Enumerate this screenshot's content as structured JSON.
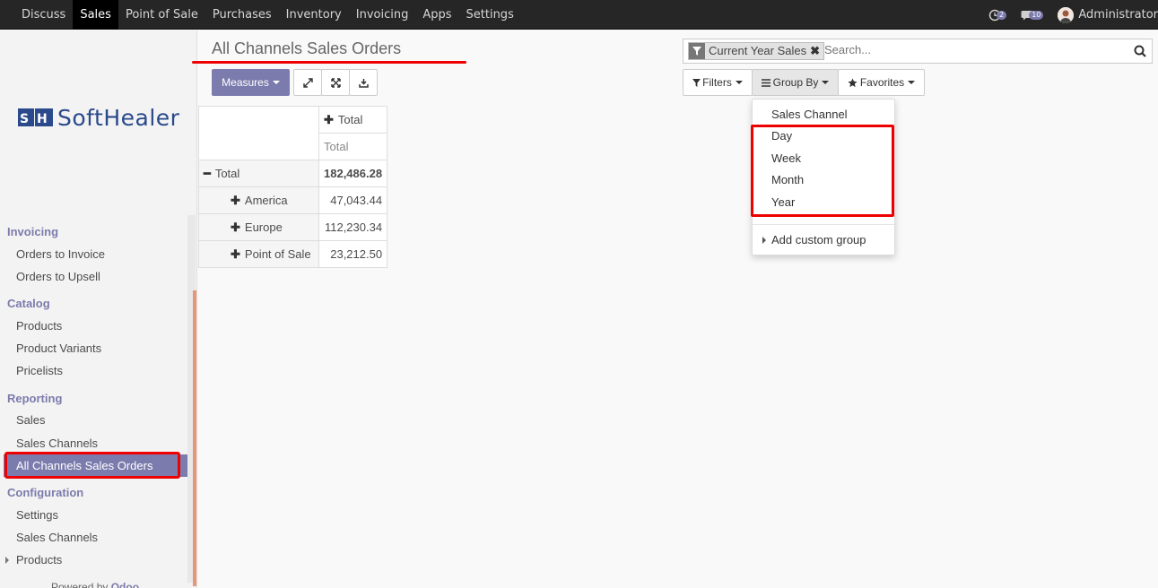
{
  "topbar": {
    "menu": [
      {
        "label": "Discuss"
      },
      {
        "label": "Sales"
      },
      {
        "label": "Point of Sale"
      },
      {
        "label": "Purchases"
      },
      {
        "label": "Inventory"
      },
      {
        "label": "Invoicing"
      },
      {
        "label": "Apps"
      },
      {
        "label": "Settings"
      }
    ],
    "activities_count": "2",
    "messages_count": "10",
    "user": "Administrator"
  },
  "sidebar": {
    "logo_text": "SoftHealer",
    "sections": [
      {
        "title": "Invoicing",
        "items": [
          "Orders to Invoice",
          "Orders to Upsell"
        ]
      },
      {
        "title": "Catalog",
        "items": [
          "Products",
          "Product Variants",
          "Pricelists"
        ]
      },
      {
        "title": "Reporting",
        "items": [
          "Sales",
          "Sales Channels",
          "All Channels Sales Orders"
        ]
      },
      {
        "title": "Configuration",
        "items": [
          "Settings",
          "Sales Channels",
          "Products"
        ]
      }
    ],
    "powered_prefix": "Powered by",
    "powered_brand": "Odoo"
  },
  "control_panel": {
    "title": "All Channels Sales Orders",
    "measures_label": "Measures",
    "filters_label": "Filters",
    "groupby_label": "Group By",
    "favorites_label": "Favorites"
  },
  "search": {
    "facet_label": "Current Year Sales",
    "placeholder": "Search..."
  },
  "groupby_dropdown": {
    "items": [
      "Sales Channel",
      "Day",
      "Week",
      "Month",
      "Year"
    ],
    "custom": "Add custom group"
  },
  "pivot": {
    "col_header": "Total",
    "col_sub": "Total",
    "total_label": "Total",
    "total_value": "182,486.28",
    "rows": [
      {
        "label": "America",
        "value": "47,043.44"
      },
      {
        "label": "Europe",
        "value": "112,230.34"
      },
      {
        "label": "Point of Sale",
        "value": "23,212.50"
      }
    ]
  },
  "colors": {
    "brand": "#7c7bad",
    "annotation": "#ee0000"
  }
}
